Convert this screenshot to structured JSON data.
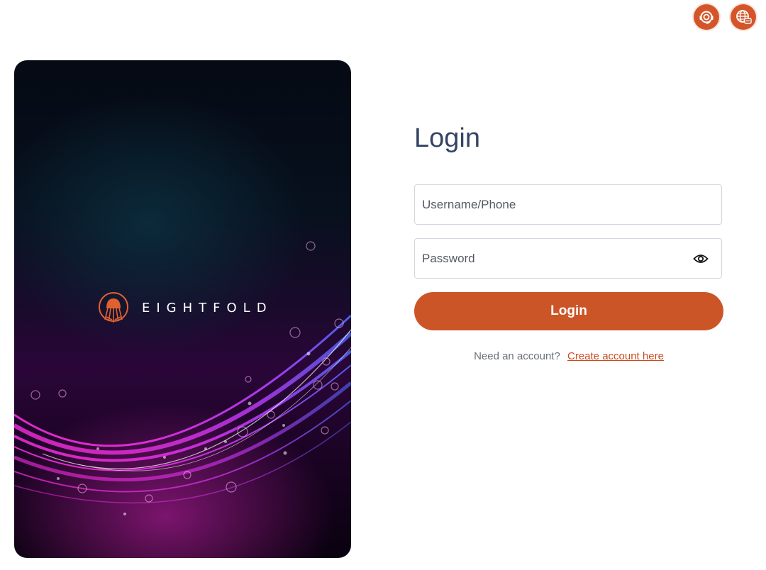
{
  "header": {
    "support_icon": "support-headset-icon",
    "language_icon": "globe-language-icon",
    "accent": "#d4552a"
  },
  "hero": {
    "brand_name": "EIGHTFOLD",
    "logo_icon": "jellyfish-logo-icon"
  },
  "login": {
    "title": "Login",
    "username_placeholder": "Username/Phone",
    "password_placeholder": "Password",
    "show_password_icon": "eye-icon",
    "submit_label": "Login",
    "signup_prompt": "Need an account?",
    "signup_link": "Create account here"
  },
  "colors": {
    "button": "#cc5528",
    "title": "#344563",
    "link": "#c94a1f"
  }
}
